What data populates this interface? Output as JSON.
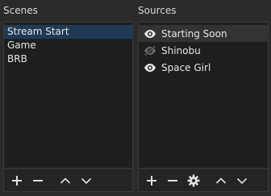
{
  "scenes": {
    "title": "Scenes",
    "items": [
      {
        "label": "Stream Start",
        "selected": true
      },
      {
        "label": "Game",
        "selected": false
      },
      {
        "label": "BRB",
        "selected": false
      }
    ],
    "toolbar": [
      "add-icon",
      "remove-icon",
      "move-up-icon",
      "move-down-icon"
    ]
  },
  "sources": {
    "title": "Sources",
    "items": [
      {
        "label": "Starting Soon",
        "visible": true,
        "selected": true
      },
      {
        "label": "Shinobu",
        "visible": false,
        "selected": false
      },
      {
        "label": "Space Girl",
        "visible": true,
        "selected": false
      }
    ],
    "toolbar": [
      "add-icon",
      "remove-icon",
      "gear-icon",
      "move-up-icon",
      "move-down-icon"
    ]
  },
  "colors": {
    "background": "#2b2b2b",
    "list_background": "#1e1e1e",
    "selection": "#203a56",
    "source_selection": "#333333",
    "text": "#e6e6e6"
  }
}
